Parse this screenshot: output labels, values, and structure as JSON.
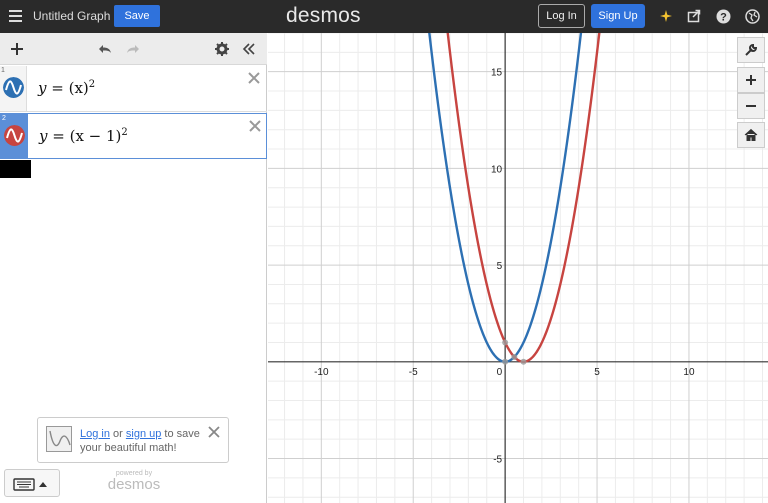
{
  "header": {
    "graph_title": "Untitled Graph",
    "save_label": "Save",
    "logo": "desmos",
    "login_label": "Log In",
    "signup_label": "Sign Up",
    "icons": [
      "menu-icon",
      "sparkle-icon",
      "share-icon",
      "help-icon",
      "language-icon"
    ]
  },
  "toolbar": {
    "icons": [
      "add-icon",
      "undo-icon",
      "redo-icon",
      "settings-icon",
      "collapse-icon"
    ]
  },
  "expressions": [
    {
      "index": "1",
      "lhs": "y",
      "rhs_base": "(x)",
      "exponent": "2",
      "color": "#2d70b3"
    },
    {
      "index": "2",
      "lhs": "y",
      "rhs_base": "(x − 1)",
      "exponent": "2",
      "color": "#c74440"
    }
  ],
  "promo": {
    "login_link": "Log in",
    "or_text": " or ",
    "signup_link": "sign up",
    "rest_text": " to save your beautiful math!"
  },
  "footer": {
    "powered_small": "powered by",
    "powered_big": "desmos"
  },
  "graph_controls": [
    "wrench-icon",
    "zoom-in-icon",
    "zoom-out-icon",
    "home-icon"
  ],
  "chart_data": {
    "type": "line",
    "xlim": [
      -12.9,
      14.3
    ],
    "ylim": [
      -7.3,
      17
    ],
    "x_tick_labels": [
      "-10",
      "-5",
      "0",
      "5",
      "10"
    ],
    "y_tick_labels": [
      "15",
      "10",
      "5",
      "-5"
    ],
    "grid": true,
    "series": [
      {
        "formula": "y=(x)^2",
        "color": "#2d70b3",
        "x": [
          -4.1,
          -3,
          -2,
          -1,
          0,
          1,
          2,
          3,
          4.1
        ],
        "y": [
          16.81,
          9,
          4,
          1,
          0,
          1,
          4,
          9,
          16.81
        ]
      },
      {
        "formula": "y=(x-1)^2",
        "color": "#c74440",
        "x": [
          -3.1,
          -2,
          -1,
          0,
          1,
          2,
          3,
          4,
          5.1
        ],
        "y": [
          16.81,
          9,
          4,
          1,
          0,
          1,
          4,
          9,
          16.81
        ]
      }
    ]
  }
}
